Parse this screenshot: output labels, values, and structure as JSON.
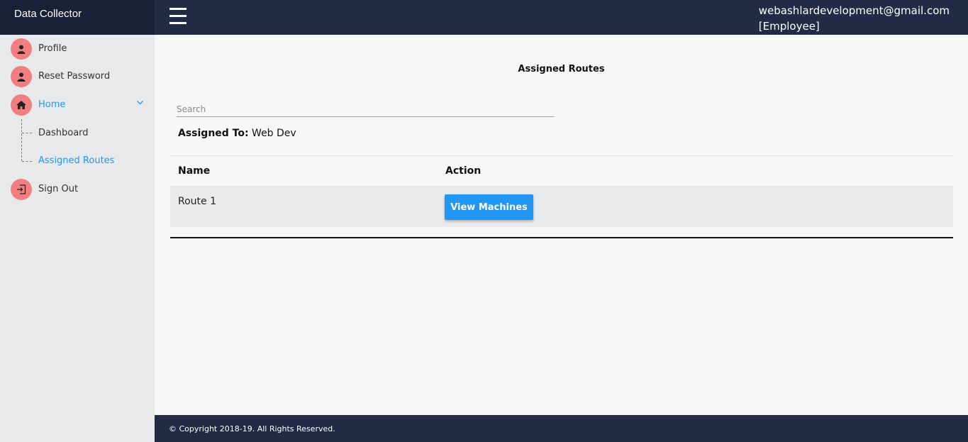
{
  "app": {
    "title": "Data Collector"
  },
  "header": {
    "user_email": "webashlardevelopment@gmail.com",
    "user_role": "[Employee]"
  },
  "sidebar": {
    "items": [
      {
        "label": "Profile",
        "icon": "user-icon"
      },
      {
        "label": "Reset Password",
        "icon": "user-icon"
      },
      {
        "label": "Home",
        "icon": "home-icon",
        "expanded": true
      },
      {
        "label": "Sign Out",
        "icon": "sign-out-icon"
      }
    ],
    "sub_items": [
      {
        "label": "Dashboard"
      },
      {
        "label": "Assigned Routes",
        "active": true
      }
    ]
  },
  "main": {
    "title": "Assigned Routes",
    "search_placeholder": "Search",
    "assigned_to_label": "Assigned To:",
    "assigned_to_value": "Web Dev",
    "table": {
      "columns": [
        "Name",
        "Action"
      ],
      "rows": [
        {
          "name": "Route 1",
          "action_label": "View Machines"
        }
      ]
    }
  },
  "footer": {
    "text": "© Copyright 2018-19. All Rights Reserved."
  },
  "colors": {
    "header_bg": "#222a45",
    "sidebar_bg": "#e8e9eb",
    "icon_bg": "#f27f7f",
    "accent": "#2196f3"
  }
}
